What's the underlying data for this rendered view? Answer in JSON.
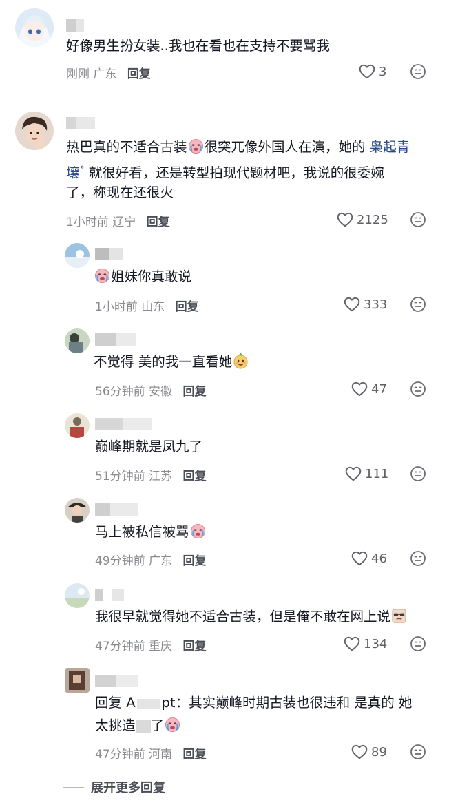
{
  "comments": [
    {
      "text": "好像男生扮女装..我也在看也在支持不要骂我",
      "time": "刚刚",
      "location": "广东",
      "reply": "回复",
      "likes": "3"
    },
    {
      "text_a": "热巴真的不适合古装",
      "text_b": "很突兀像外国人在演，她的 ",
      "link": "枭起青",
      "text_c": "壤",
      "sup": "Q",
      "text_d": " 就很好看，还是转型拍现代题材吧，我说的很委婉",
      "text_e": "了，称现在还很火",
      "time": "1小时前",
      "location": "辽宁",
      "reply": "回复",
      "likes": "2125"
    }
  ],
  "replies": [
    {
      "text": "姐妹你真敢说",
      "time": "1小时前",
      "location": "山东",
      "reply": "回复",
      "likes": "333"
    },
    {
      "text": "不觉得 美的我一直看她",
      "time": "56分钟前",
      "location": "安徽",
      "reply": "回复",
      "likes": "47"
    },
    {
      "text": "巅峰期就是凤九了",
      "time": "51分钟前",
      "location": "江苏",
      "reply": "回复",
      "likes": "111"
    },
    {
      "text": "马上被私信被骂",
      "time": "49分钟前",
      "location": "广东",
      "reply": "回复",
      "likes": "46"
    },
    {
      "text": "我很早就觉得她不适合古装，但是俺不敢在网上说",
      "time": "47分钟前",
      "location": "重庆",
      "reply": "回复",
      "likes": "134"
    },
    {
      "text_a": "回复 ",
      "text_a2": "A",
      "text_a3": "pt：其实巅峰时期古装也很违和 是真的 她",
      "text_b": "太挑造",
      "text_b2": "了",
      "time": "47分钟前",
      "location": "河南",
      "reply": "回复",
      "likes": "89"
    }
  ],
  "expand_label": "展开更多回复",
  "colors": {
    "link": "#2b4b86",
    "meta": "#8a8b91",
    "text": "#161823"
  }
}
